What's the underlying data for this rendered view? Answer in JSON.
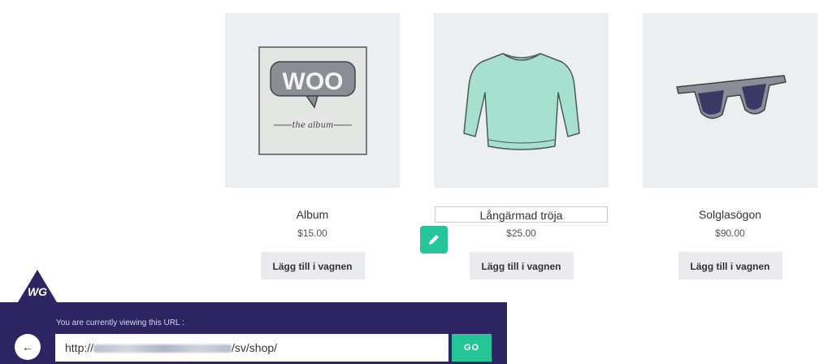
{
  "products": [
    {
      "name": "Album",
      "price": "$15.00",
      "button": "Lägg till i vagnen",
      "image": "album-cover"
    },
    {
      "name": "Långärmad tröja",
      "price": "$25.00",
      "button": "Lägg till i vagnen",
      "image": "long-sleeve-shirt"
    },
    {
      "name": "Solglasögon",
      "price": "$90.00",
      "button": "Lägg till i vagnen",
      "image": "sunglasses"
    }
  ],
  "album_art": {
    "logo": "WOO",
    "subtitle": "the album"
  },
  "wg_bar": {
    "logo": "WG",
    "caption": "You are currently viewing this URL :",
    "url_prefix": "http://",
    "url_suffix": "/sv/shop/",
    "go_label": "GO",
    "back_icon": "←"
  },
  "colors": {
    "accent": "#25c59a",
    "bar_background": "#2c2561",
    "thumb_background": "#eceff1",
    "button_background": "#e9ebef"
  }
}
